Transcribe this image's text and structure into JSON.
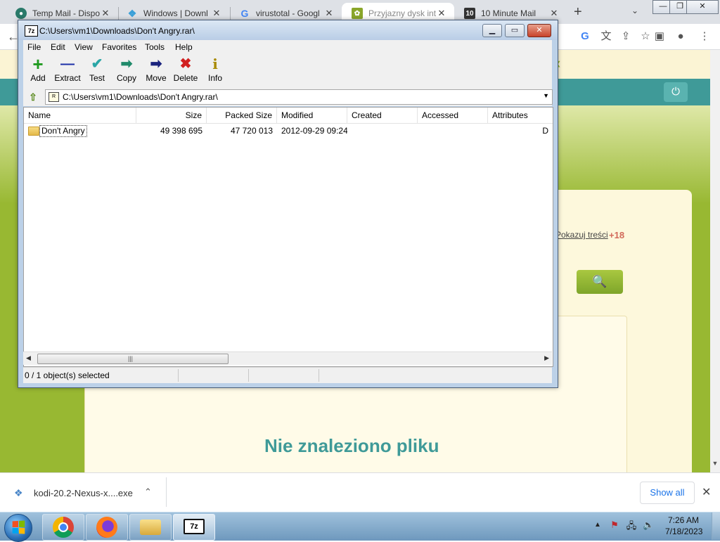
{
  "browser": {
    "tabs": [
      {
        "label": "Temp Mail - Dispo",
        "favicon": "tempmail-icon",
        "favicon_color": "#2a7a6a"
      },
      {
        "label": "Windows | Downl",
        "favicon": "kodi-icon",
        "favicon_color": "#3aa0d8"
      },
      {
        "label": "virustotal - Googl",
        "favicon": "google-icon",
        "favicon_color": "#4285f4"
      },
      {
        "label": "Przyjazny dysk int",
        "favicon": "chomikuj-icon",
        "favicon_color": "#8aa62a"
      },
      {
        "label": "10 Minute Mail",
        "favicon": "tenminutemail-icon",
        "favicon_color": "#333333"
      }
    ],
    "active_tab": 3
  },
  "webpage": {
    "content_link": "Pokazuj treści",
    "adult_badge": "+18",
    "not_found": "Nie znaleziono pliku"
  },
  "zip": {
    "title": "C:\\Users\\vm1\\Downloads\\Don't Angry.rar\\",
    "logo": "7z",
    "menu": [
      "File",
      "Edit",
      "View",
      "Favorites",
      "Tools",
      "Help"
    ],
    "toolbar": [
      {
        "label": "Add",
        "icon": "+",
        "color": "#1f9a1f",
        "name": "add"
      },
      {
        "label": "Extract",
        "icon": "—",
        "color": "#1c2fa8",
        "name": "extract"
      },
      {
        "label": "Test",
        "icon": "✔",
        "color": "#2aa6a6",
        "name": "test"
      },
      {
        "label": "Copy",
        "icon": "➡",
        "color": "#1f8a6a",
        "name": "copy"
      },
      {
        "label": "Move",
        "icon": "➡",
        "color": "#1a237e",
        "name": "move"
      },
      {
        "label": "Delete",
        "icon": "✖",
        "color": "#d11f1f",
        "name": "delete"
      },
      {
        "label": "Info",
        "icon": "i",
        "color": "#a88a00",
        "name": "info"
      }
    ],
    "address": "C:\\Users\\vm1\\Downloads\\Don't Angry.rar\\",
    "columns": [
      "Name",
      "Size",
      "Packed Size",
      "Modified",
      "Created",
      "Accessed",
      "Attributes"
    ],
    "rows": [
      {
        "name": "Don't Angry",
        "size": "49 398 695",
        "packed": "47 720 013",
        "modified": "2012-09-29 09:24",
        "created": "",
        "accessed": "",
        "attributes": "D"
      }
    ],
    "status": "0 / 1 object(s) selected"
  },
  "download": {
    "filename": "kodi-20.2-Nexus-x....exe",
    "show_all": "Show all"
  },
  "taskbar": {
    "time": "7:26 AM",
    "date": "7/18/2023"
  }
}
